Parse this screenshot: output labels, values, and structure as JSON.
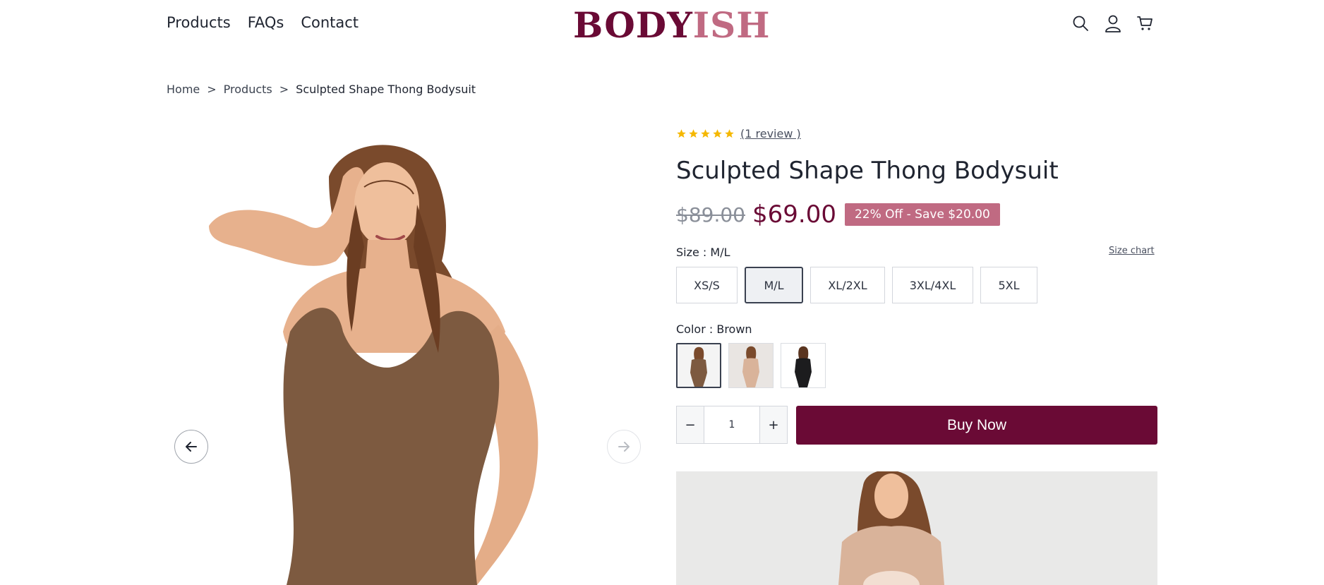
{
  "header": {
    "nav": [
      "Products",
      "FAQs",
      "Contact"
    ],
    "logo_part1": "BODY",
    "logo_part2": "ISH",
    "icons": [
      "search-icon",
      "account-icon",
      "cart-icon"
    ]
  },
  "breadcrumb": {
    "home": "Home",
    "sep": ">",
    "products": "Products",
    "current": "Sculpted Shape Thong Bodysuit"
  },
  "gallery": {
    "prev_icon": "arrow-left-icon",
    "next_icon": "arrow-right-icon"
  },
  "product": {
    "rating_stars": 5,
    "review_text": "(1 review )",
    "title": "Sculpted Shape Thong Bodysuit",
    "old_price": "$89.00",
    "new_price": "$69.00",
    "badge": "22% Off - Save $20.00",
    "size_label": "Size : M/L",
    "size_chart": "Size chart",
    "sizes": [
      "XS/S",
      "M/L",
      "XL/2XL",
      "3XL/4XL",
      "5XL"
    ],
    "selected_size": "M/L",
    "color_label": "Color : Brown",
    "selected_color_index": 0,
    "quantity": "1",
    "minus": "−",
    "plus": "+",
    "buy_label": "Buy Now"
  },
  "colors": {
    "accent": "#6a0a35",
    "badge": "#c06a82",
    "star": "#f5b800"
  }
}
